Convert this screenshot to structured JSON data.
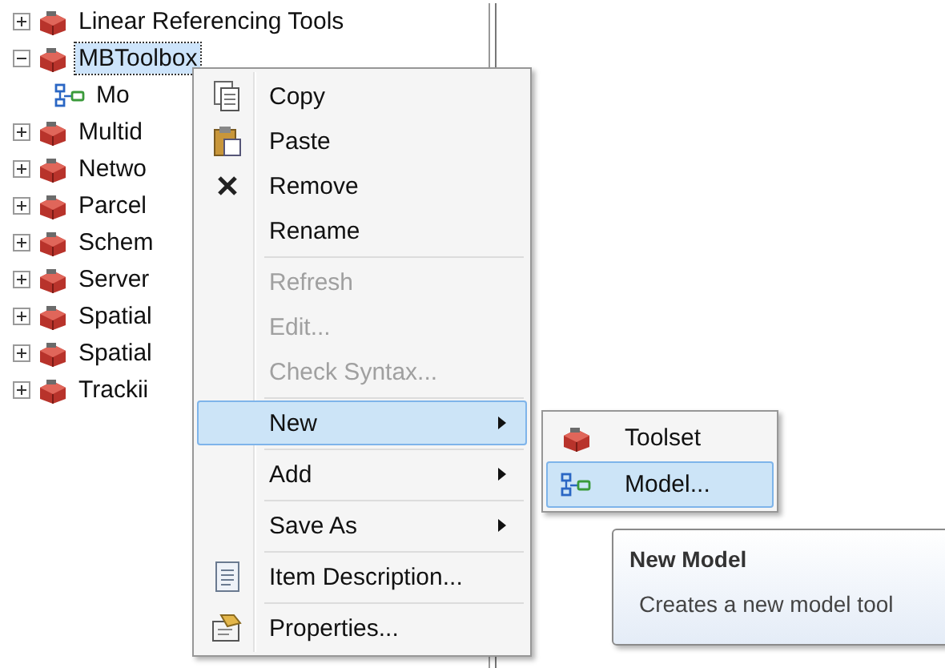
{
  "tree": {
    "items": [
      {
        "label": "Linear Referencing Tools",
        "expanded": false,
        "selected": false
      },
      {
        "label": "MBToolbox",
        "expanded": true,
        "selected": true,
        "children": [
          {
            "label": "Mo"
          }
        ]
      },
      {
        "label": "Multid",
        "expanded": false,
        "selected": false
      },
      {
        "label": "Netwo",
        "expanded": false,
        "selected": false
      },
      {
        "label": "Parcel",
        "expanded": false,
        "selected": false
      },
      {
        "label": "Schem",
        "expanded": false,
        "selected": false
      },
      {
        "label": "Server",
        "expanded": false,
        "selected": false
      },
      {
        "label": "Spatial",
        "expanded": false,
        "selected": false
      },
      {
        "label": "Spatial",
        "expanded": false,
        "selected": false
      },
      {
        "label": "Trackii",
        "expanded": false,
        "selected": false
      }
    ]
  },
  "context_menu": {
    "items": [
      {
        "kind": "item",
        "label": "Copy",
        "disabled": false,
        "selected": false,
        "submenu": false
      },
      {
        "kind": "item",
        "label": "Paste",
        "disabled": false,
        "selected": false,
        "submenu": false
      },
      {
        "kind": "item",
        "label": "Remove",
        "disabled": false,
        "selected": false,
        "submenu": false
      },
      {
        "kind": "item",
        "label": "Rename",
        "disabled": false,
        "selected": false,
        "submenu": false
      },
      {
        "kind": "separator"
      },
      {
        "kind": "item",
        "label": "Refresh",
        "disabled": true,
        "selected": false,
        "submenu": false
      },
      {
        "kind": "item",
        "label": "Edit...",
        "disabled": true,
        "selected": false,
        "submenu": false
      },
      {
        "kind": "item",
        "label": "Check Syntax...",
        "disabled": true,
        "selected": false,
        "submenu": false
      },
      {
        "kind": "separator"
      },
      {
        "kind": "item",
        "label": "New",
        "disabled": false,
        "selected": true,
        "submenu": true
      },
      {
        "kind": "separator"
      },
      {
        "kind": "item",
        "label": "Add",
        "disabled": false,
        "selected": false,
        "submenu": true
      },
      {
        "kind": "separator"
      },
      {
        "kind": "item",
        "label": "Save As",
        "disabled": false,
        "selected": false,
        "submenu": true
      },
      {
        "kind": "separator"
      },
      {
        "kind": "item",
        "label": "Item Description...",
        "disabled": false,
        "selected": false,
        "submenu": false
      },
      {
        "kind": "separator"
      },
      {
        "kind": "item",
        "label": "Properties...",
        "disabled": false,
        "selected": false,
        "submenu": false
      }
    ]
  },
  "submenu": {
    "items": [
      {
        "label": "Toolset",
        "selected": false
      },
      {
        "label": "Model...",
        "selected": true
      }
    ]
  },
  "tooltip": {
    "title": "New Model",
    "text": "Creates a new model tool"
  }
}
